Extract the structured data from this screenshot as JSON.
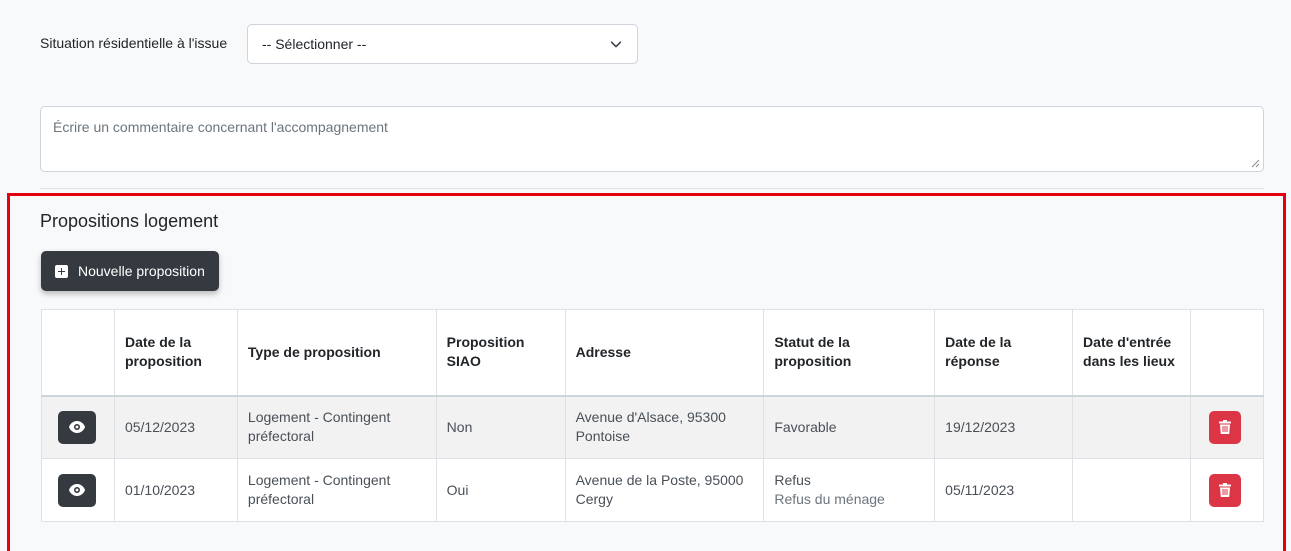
{
  "form": {
    "situation_label": "Situation résidentielle à l'issue",
    "situation_select_value": "-- Sélectionner --",
    "comment_placeholder": "Écrire un commentaire concernant l'accompagnement"
  },
  "section": {
    "title": "Propositions logement",
    "new_button_label": "Nouvelle proposition"
  },
  "table": {
    "headers": [
      "",
      "Date de la proposition",
      "Type de proposition",
      "Proposition SIAO",
      "Adresse",
      "Statut de la proposition",
      "Date de la réponse",
      "Date d'entrée dans les lieux",
      ""
    ],
    "rows": [
      {
        "date_proposition": "05/12/2023",
        "type": "Logement - Contingent préfectoral",
        "siao": "Non",
        "adresse": "Avenue d'Alsace, 95300 Pontoise",
        "statut": "Favorable",
        "statut_detail": "",
        "date_reponse": "19/12/2023",
        "date_entree": ""
      },
      {
        "date_proposition": "01/10/2023",
        "type": "Logement - Contingent préfectoral",
        "siao": "Oui",
        "adresse": "Avenue de la Poste, 95000 Cergy",
        "statut": "Refus",
        "statut_detail": "Refus du ménage",
        "date_reponse": "05/11/2023",
        "date_entree": ""
      }
    ]
  },
  "icons": {
    "view": "eye-icon",
    "delete": "trash-icon",
    "add": "plus-square-icon",
    "dropdown": "chevron-down-icon"
  },
  "colors": {
    "highlight_border": "#e3000f",
    "dark_button": "#343a40",
    "danger_button": "#dc3545"
  }
}
